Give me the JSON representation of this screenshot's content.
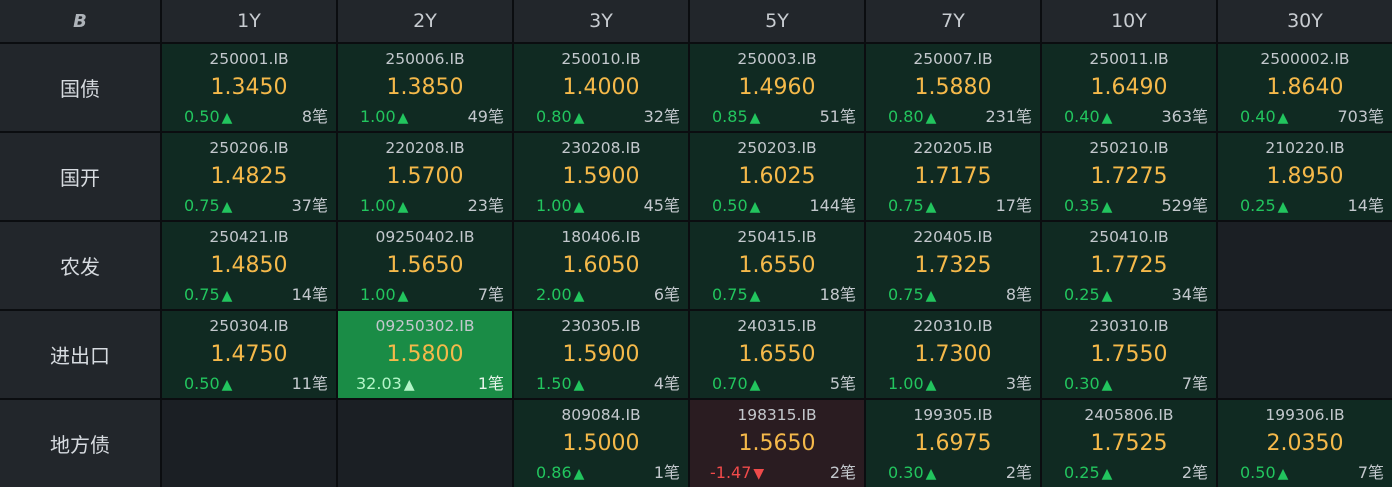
{
  "header": {
    "logo": "B",
    "columns": [
      "1Y",
      "2Y",
      "3Y",
      "5Y",
      "7Y",
      "10Y",
      "30Y"
    ]
  },
  "rows": [
    {
      "label": "国债",
      "cells": [
        {
          "code": "250001.IB",
          "yield": "1.3450",
          "change": "0.50",
          "dir": "up",
          "count": "8笔"
        },
        {
          "code": "250006.IB",
          "yield": "1.3850",
          "change": "1.00",
          "dir": "up",
          "count": "49笔"
        },
        {
          "code": "250010.IB",
          "yield": "1.4000",
          "change": "0.80",
          "dir": "up",
          "count": "32笔"
        },
        {
          "code": "250003.IB",
          "yield": "1.4960",
          "change": "0.85",
          "dir": "up",
          "count": "51笔"
        },
        {
          "code": "250007.IB",
          "yield": "1.5880",
          "change": "0.80",
          "dir": "up",
          "count": "231笔"
        },
        {
          "code": "250011.IB",
          "yield": "1.6490",
          "change": "0.40",
          "dir": "up",
          "count": "363笔"
        },
        {
          "code": "2500002.IB",
          "yield": "1.8640",
          "change": "0.40",
          "dir": "up",
          "count": "703笔"
        }
      ]
    },
    {
      "label": "国开",
      "cells": [
        {
          "code": "250206.IB",
          "yield": "1.4825",
          "change": "0.75",
          "dir": "up",
          "count": "37笔"
        },
        {
          "code": "220208.IB",
          "yield": "1.5700",
          "change": "1.00",
          "dir": "up",
          "count": "23笔"
        },
        {
          "code": "230208.IB",
          "yield": "1.5900",
          "change": "1.00",
          "dir": "up",
          "count": "45笔"
        },
        {
          "code": "250203.IB",
          "yield": "1.6025",
          "change": "0.50",
          "dir": "up",
          "count": "144笔"
        },
        {
          "code": "220205.IB",
          "yield": "1.7175",
          "change": "0.75",
          "dir": "up",
          "count": "17笔"
        },
        {
          "code": "250210.IB",
          "yield": "1.7275",
          "change": "0.35",
          "dir": "up",
          "count": "529笔"
        },
        {
          "code": "210220.IB",
          "yield": "1.8950",
          "change": "0.25",
          "dir": "up",
          "count": "14笔"
        }
      ]
    },
    {
      "label": "农发",
      "cells": [
        {
          "code": "250421.IB",
          "yield": "1.4850",
          "change": "0.75",
          "dir": "up",
          "count": "14笔"
        },
        {
          "code": "09250402.IB",
          "yield": "1.5650",
          "change": "1.00",
          "dir": "up",
          "count": "7笔"
        },
        {
          "code": "180406.IB",
          "yield": "1.6050",
          "change": "2.00",
          "dir": "up",
          "count": "6笔"
        },
        {
          "code": "250415.IB",
          "yield": "1.6550",
          "change": "0.75",
          "dir": "up",
          "count": "18笔"
        },
        {
          "code": "220405.IB",
          "yield": "1.7325",
          "change": "0.75",
          "dir": "up",
          "count": "8笔"
        },
        {
          "code": "250410.IB",
          "yield": "1.7725",
          "change": "0.25",
          "dir": "up",
          "count": "34笔"
        },
        null
      ]
    },
    {
      "label": "进出口",
      "cells": [
        {
          "code": "250304.IB",
          "yield": "1.4750",
          "change": "0.50",
          "dir": "up",
          "count": "11笔"
        },
        {
          "code": "09250302.IB",
          "yield": "1.5800",
          "change": "32.03",
          "dir": "up",
          "count": "1笔",
          "highlight": "hot"
        },
        {
          "code": "230305.IB",
          "yield": "1.5900",
          "change": "1.50",
          "dir": "up",
          "count": "4笔"
        },
        {
          "code": "240315.IB",
          "yield": "1.6550",
          "change": "0.70",
          "dir": "up",
          "count": "5笔"
        },
        {
          "code": "220310.IB",
          "yield": "1.7300",
          "change": "1.00",
          "dir": "up",
          "count": "3笔"
        },
        {
          "code": "230310.IB",
          "yield": "1.7550",
          "change": "0.30",
          "dir": "up",
          "count": "7笔"
        },
        null
      ]
    },
    {
      "label": "地方债",
      "cells": [
        null,
        null,
        {
          "code": "809084.IB",
          "yield": "1.5000",
          "change": "0.86",
          "dir": "up",
          "count": "1笔"
        },
        {
          "code": "198315.IB",
          "yield": "1.5650",
          "change": "-1.47",
          "dir": "down",
          "count": "2笔",
          "highlight": "neg"
        },
        {
          "code": "199305.IB",
          "yield": "1.6975",
          "change": "0.30",
          "dir": "up",
          "count": "2笔"
        },
        {
          "code": "2405806.IB",
          "yield": "1.7525",
          "change": "0.25",
          "dir": "up",
          "count": "2笔"
        },
        {
          "code": "199306.IB",
          "yield": "2.0350",
          "change": "0.50",
          "dir": "up",
          "count": "7笔"
        }
      ]
    }
  ],
  "colors": {
    "background": "#0b0d10",
    "header_bg": "#22262b",
    "cell_bg": "#102a22",
    "hot_bg": "#1a8c46",
    "neg_bg": "#2a1c21",
    "empty_bg": "#1b1f24",
    "yield": "#f5b94a",
    "up": "#22c55e",
    "down": "#f04a4a"
  },
  "icons": {
    "up": "triangle-up-icon",
    "down": "triangle-down-icon"
  }
}
